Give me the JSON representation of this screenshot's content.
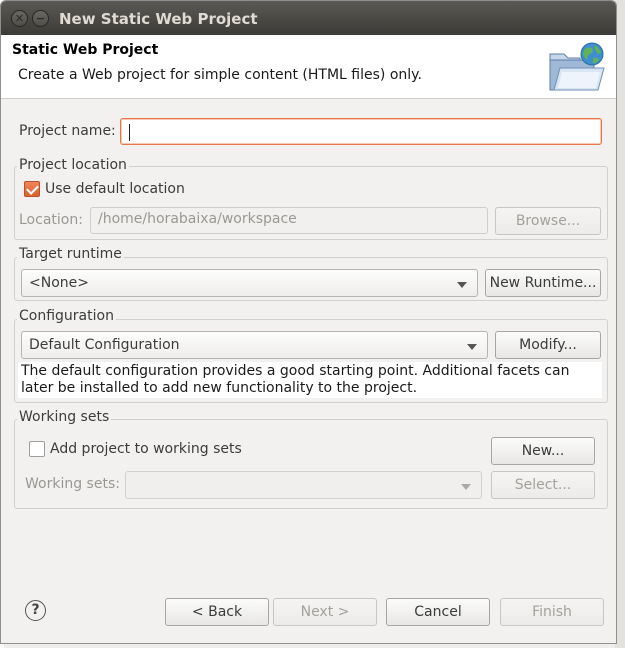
{
  "window": {
    "title": "New Static Web Project",
    "close_glyph": "✕",
    "minimize_glyph": "−"
  },
  "header": {
    "title": "Static Web Project",
    "message": "Create a Web project for simple content (HTML files) only.",
    "icon": "folder-globe-icon"
  },
  "project_name": {
    "label": "Project name:",
    "value": ""
  },
  "project_location": {
    "group_title": "Project location",
    "use_default_label": "Use default location",
    "use_default_checked": true,
    "location_label": "Location:",
    "location_value": "/home/horabaixa/workspace",
    "browse_label": "Browse..."
  },
  "target_runtime": {
    "group_title": "Target runtime",
    "selected": "<None>",
    "new_runtime_label": "New Runtime..."
  },
  "configuration": {
    "group_title": "Configuration",
    "selected": "Default Configuration",
    "modify_label": "Modify...",
    "description": "The default configuration provides a good starting point. Additional facets can later be installed to add new functionality to the project."
  },
  "working_sets": {
    "group_title": "Working sets",
    "add_label": "Add project to working sets",
    "add_checked": false,
    "new_label": "New...",
    "sets_label": "Working sets:",
    "sets_value": "",
    "select_label": "Select..."
  },
  "footer": {
    "help_glyph": "?",
    "back_label": "< Back",
    "next_label": "Next >",
    "cancel_label": "Cancel",
    "finish_label": "Finish"
  },
  "colors": {
    "accent": "#e9764b",
    "titlebar": "#3c3b37",
    "dialog_bg": "#f2f1f0"
  }
}
